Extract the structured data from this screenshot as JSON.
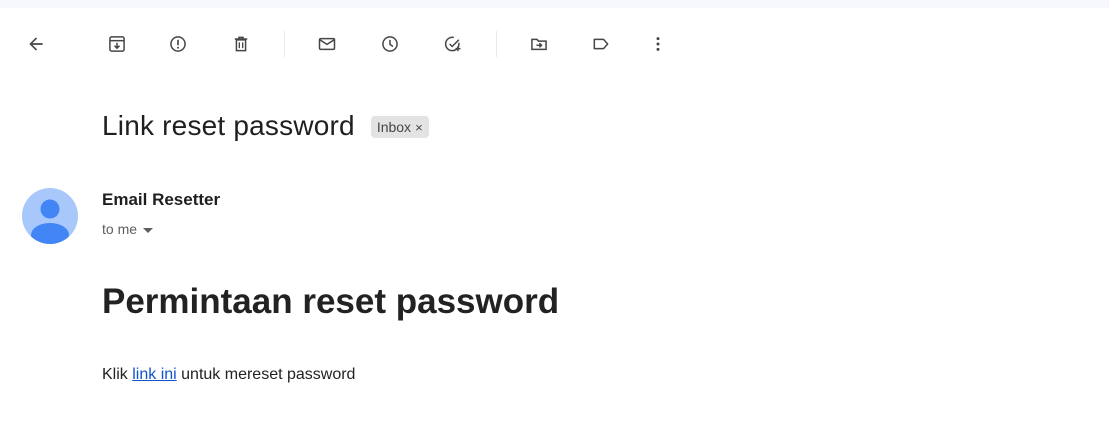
{
  "toolbar": {
    "icons": [
      "arrow-back-icon",
      "archive-icon",
      "report-spam-icon",
      "delete-icon",
      "mark-unread-icon",
      "snooze-icon",
      "add-to-tasks-icon",
      "move-to-icon",
      "label-icon",
      "more-vert-icon"
    ]
  },
  "email": {
    "subject": "Link reset password",
    "label_chip": "Inbox",
    "label_remove": "×",
    "sender": "Email Resetter",
    "recipient": "to me",
    "heading": "Permintaan reset password",
    "body_prefix": "Klik ",
    "link_text": "link ini",
    "body_suffix": " untuk mereset password"
  },
  "colors": {
    "avatar_bg": "#a8c7fa",
    "avatar_fg": "#4285f4",
    "link": "#1155cc",
    "chip_bg": "#e3e3e3"
  }
}
